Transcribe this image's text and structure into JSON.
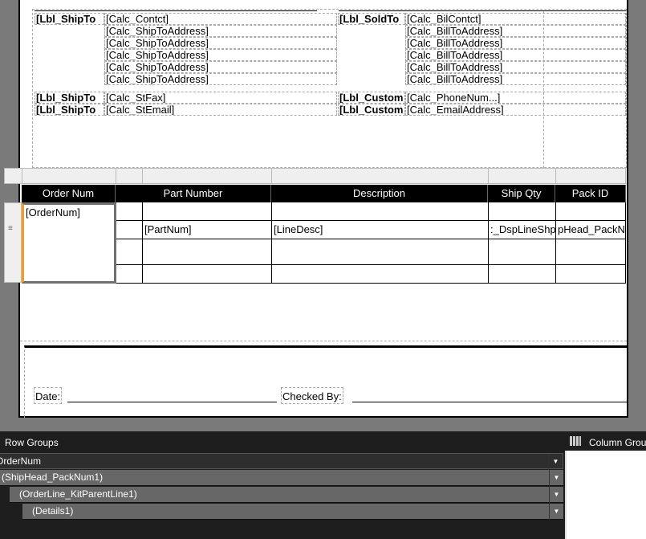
{
  "header": {
    "ship_to": {
      "label": "[Lbl_ShipTo",
      "contact": "[Calc_Contct]",
      "address_lines": [
        "[Calc_ShipToAddress]",
        "[Calc_ShipToAddress]",
        "[Calc_ShipToAddress]",
        "[Calc_ShipToAddress]",
        "[Calc_ShipToAddress]"
      ],
      "fax_label": "[Lbl_ShipTo",
      "fax": "[Calc_StFax]",
      "email_label": "[Lbl_ShipTo",
      "email": "[Calc_StEmail]"
    },
    "sold_to": {
      "label": "[Lbl_SoldTo",
      "contact": "[Calc_BilContct]",
      "address_lines": [
        "[Calc_BillToAddress]",
        "[Calc_BillToAddress]",
        "[Calc_BillToAddress]",
        "[Calc_BillToAddress]",
        "[Calc_BillToAddress]"
      ],
      "phone_label": "[Lbl_Custom",
      "phone": "[Calc_PhoneNum...]",
      "email_label": "[Lbl_Custom",
      "email": "[Calc_EmailAddress]"
    }
  },
  "table": {
    "columns": [
      "Order Num",
      "Part Number",
      "Description",
      "Ship Qty",
      "Pack ID"
    ],
    "order_cell": "[OrderNum]",
    "detail": {
      "part": "[PartNum]",
      "desc": "[LineDesc]",
      "qty": ":_DspLineShp",
      "pack": "pHead_PackN"
    }
  },
  "footer": {
    "date_label": "Date:",
    "checked_label": "Checked By:"
  },
  "panel": {
    "row_groups_title": "Row Groups",
    "column_groups_title": "Column Groups",
    "groups": [
      "OrderNum",
      "(ShipHead_PackNum1)",
      "(OrderLine_KitParentLine1)",
      "(Details1)"
    ]
  }
}
